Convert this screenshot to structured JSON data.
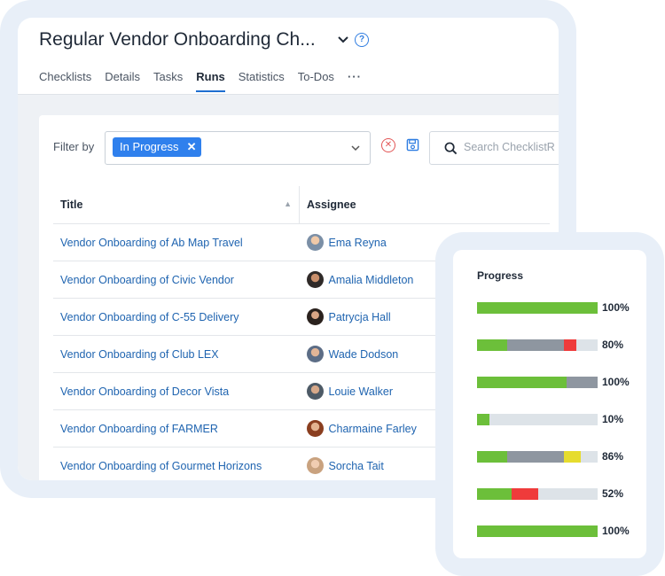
{
  "page": {
    "title": "Regular Vendor Onboarding Ch...",
    "tabs": [
      "Checklists",
      "Details",
      "Tasks",
      "Runs",
      "Statistics",
      "To-Dos"
    ],
    "active_tab": "Runs"
  },
  "filter": {
    "label": "Filter by",
    "chip": "In Progress",
    "search_placeholder": "Search ChecklistR"
  },
  "table": {
    "columns": [
      "Title",
      "Assignee"
    ],
    "rows": [
      {
        "title": "Vendor Onboarding of Ab Map Travel",
        "assignee": "Ema Reyna"
      },
      {
        "title": "Vendor Onboarding of Civic Vendor",
        "assignee": "Amalia Middleton"
      },
      {
        "title": "Vendor Onboarding of C-55 Delivery",
        "assignee": "Patrycja Hall"
      },
      {
        "title": "Vendor Onboarding of Club LEX",
        "assignee": "Wade Dodson"
      },
      {
        "title": "Vendor Onboarding of Decor Vista",
        "assignee": "Louie Walker"
      },
      {
        "title": "Vendor Onboarding of FARMER",
        "assignee": "Charmaine Farley"
      },
      {
        "title": "Vendor Onboarding of Gourmet Horizons",
        "assignee": "Sorcha Tait"
      }
    ]
  },
  "progress": {
    "title": "Progress",
    "colors": {
      "done": "#6cbf3a",
      "skipped": "#8e96a0",
      "overdue": "#ef3b3b",
      "pending": "#e6dc2e",
      "remaining": "#dde3e8"
    },
    "rows": [
      {
        "label": "100%",
        "segments": [
          {
            "status": "done",
            "fraction": 1.0
          }
        ]
      },
      {
        "label": "80%",
        "segments": [
          {
            "status": "done",
            "fraction": 0.25
          },
          {
            "status": "skipped",
            "fraction": 0.47
          },
          {
            "status": "overdue",
            "fraction": 0.1
          }
        ]
      },
      {
        "label": "100%",
        "segments": [
          {
            "status": "done",
            "fraction": 0.74
          },
          {
            "status": "skipped",
            "fraction": 0.26
          }
        ]
      },
      {
        "label": "10%",
        "segments": [
          {
            "status": "done",
            "fraction": 0.1
          }
        ]
      },
      {
        "label": "86%",
        "segments": [
          {
            "status": "done",
            "fraction": 0.25
          },
          {
            "status": "skipped",
            "fraction": 0.47
          },
          {
            "status": "pending",
            "fraction": 0.14
          }
        ]
      },
      {
        "label": "52%",
        "segments": [
          {
            "status": "done",
            "fraction": 0.29
          },
          {
            "status": "overdue",
            "fraction": 0.22
          }
        ]
      },
      {
        "label": "100%",
        "segments": [
          {
            "status": "done",
            "fraction": 1.0
          }
        ]
      }
    ]
  }
}
